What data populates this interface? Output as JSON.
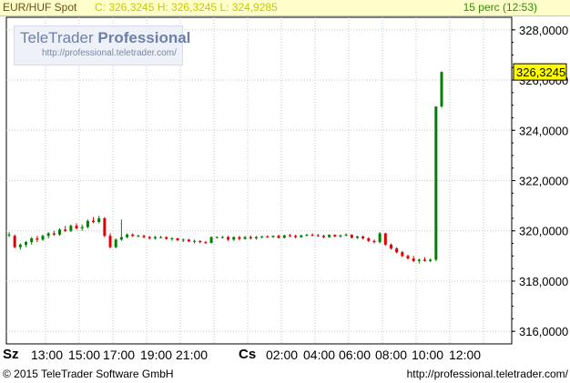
{
  "header": {
    "instrument": "EUR/HUF Spot",
    "ohlc": "C: 326,3245 H: 326,3245 L: 324,9285",
    "period": "15 perc (12:53)"
  },
  "logo": {
    "title_part1": "TeleTrader",
    "title_part2": "Professional",
    "url": "http://professional.teletrader.com/"
  },
  "footer": {
    "copyright": "© 2015 TeleTrader Software GmbH",
    "url": "http://professional.teletrader.com/"
  },
  "colors": {
    "up": "#008000",
    "down": "#e00000",
    "neutral": "#00ffff",
    "price_marker": "#ffff00"
  },
  "chart_data": {
    "type": "candlestick",
    "y_axis": {
      "min": 315.5,
      "max": 328.5,
      "ticks": [
        316,
        318,
        320,
        322,
        324,
        326,
        328
      ],
      "tick_labels": [
        "316,0000",
        "318,0000",
        "320,0000",
        "322,0000",
        "324,0000",
        "326,0000",
        "328,0000"
      ],
      "last_price_label": "326,3245",
      "last_price": 326.3245
    },
    "x_axis": {
      "day_labels": [
        {
          "label": "Sz",
          "pos": 0.0
        },
        {
          "label": "Cs",
          "pos": 0.5
        }
      ],
      "time_labels": [
        {
          "label": "13:00",
          "pos": 0.0
        },
        {
          "label": "15:00",
          "pos": 0.0
        },
        {
          "label": "17:00",
          "pos": 0.0
        },
        {
          "label": "19:00",
          "pos": 0.0
        },
        {
          "label": "21:00",
          "pos": 0.0
        },
        {
          "label": "02:00",
          "pos": 0.0
        },
        {
          "label": "04:00",
          "pos": 0.0
        },
        {
          "label": "06:00",
          "pos": 0.0
        },
        {
          "label": "08:00",
          "pos": 0.0
        },
        {
          "label": "10:00",
          "pos": 0.0
        },
        {
          "label": "12:00",
          "pos": 0.0
        }
      ]
    },
    "grid": true,
    "candles": [
      [
        319.85,
        319.95,
        319.75,
        319.85
      ],
      [
        319.8,
        319.85,
        319.3,
        319.35
      ],
      [
        319.35,
        319.5,
        319.25,
        319.45
      ],
      [
        319.45,
        319.6,
        319.35,
        319.55
      ],
      [
        319.55,
        319.75,
        319.45,
        319.7
      ],
      [
        319.7,
        319.8,
        319.55,
        319.65
      ],
      [
        319.65,
        319.85,
        319.6,
        319.8
      ],
      [
        319.8,
        319.95,
        319.7,
        319.9
      ],
      [
        319.9,
        320.0,
        319.8,
        319.85
      ],
      [
        319.85,
        320.1,
        319.8,
        320.05
      ],
      [
        320.05,
        320.2,
        319.95,
        320.0
      ],
      [
        320.0,
        320.25,
        319.95,
        320.2
      ],
      [
        320.2,
        320.3,
        320.05,
        320.1
      ],
      [
        320.1,
        320.25,
        320.0,
        320.15
      ],
      [
        320.15,
        320.45,
        320.1,
        320.4
      ],
      [
        320.4,
        320.55,
        320.3,
        320.35
      ],
      [
        320.35,
        320.6,
        320.3,
        320.5
      ],
      [
        320.5,
        320.55,
        319.75,
        319.8
      ],
      [
        319.8,
        319.9,
        319.3,
        319.35
      ],
      [
        319.35,
        319.7,
        319.3,
        319.65
      ],
      [
        319.65,
        320.45,
        319.6,
        319.75
      ],
      [
        319.75,
        319.9,
        319.7,
        319.85
      ],
      [
        319.85,
        319.9,
        319.75,
        319.8
      ],
      [
        319.8,
        319.85,
        319.75,
        319.8
      ],
      [
        319.8,
        319.85,
        319.7,
        319.75
      ],
      [
        319.75,
        319.8,
        319.65,
        319.7
      ],
      [
        319.7,
        319.8,
        319.65,
        319.75
      ],
      [
        319.75,
        319.8,
        319.7,
        319.75
      ],
      [
        319.75,
        319.78,
        319.65,
        319.68
      ],
      [
        319.68,
        319.75,
        319.6,
        319.7
      ],
      [
        319.7,
        319.72,
        319.6,
        319.62
      ],
      [
        319.62,
        319.7,
        319.55,
        319.65
      ],
      [
        319.65,
        319.68,
        319.55,
        319.58
      ],
      [
        319.58,
        319.65,
        319.5,
        319.6
      ],
      [
        319.6,
        319.62,
        319.5,
        319.55
      ],
      [
        319.55,
        319.6,
        319.48,
        319.52
      ],
      [
        319.52,
        319.78,
        319.5,
        319.75
      ],
      [
        319.75,
        319.78,
        319.7,
        319.75
      ],
      [
        319.75,
        319.8,
        319.7,
        319.75
      ],
      [
        319.75,
        319.8,
        319.6,
        319.65
      ],
      [
        319.65,
        319.78,
        319.6,
        319.75
      ],
      [
        319.75,
        319.8,
        319.62,
        319.68
      ],
      [
        319.68,
        319.8,
        319.65,
        319.75
      ],
      [
        319.75,
        319.82,
        319.65,
        319.7
      ],
      [
        319.7,
        319.8,
        319.65,
        319.75
      ],
      [
        319.75,
        319.8,
        319.7,
        319.78
      ],
      [
        319.78,
        319.82,
        319.72,
        319.75
      ],
      [
        319.75,
        319.82,
        319.72,
        319.8
      ],
      [
        319.8,
        319.85,
        319.7,
        319.72
      ],
      [
        319.72,
        319.85,
        319.7,
        319.82
      ],
      [
        319.82,
        319.88,
        319.75,
        319.8
      ],
      [
        319.8,
        319.85,
        319.7,
        319.75
      ],
      [
        319.75,
        319.85,
        319.72,
        319.82
      ],
      [
        319.82,
        319.88,
        319.78,
        319.84
      ],
      [
        319.84,
        319.9,
        319.78,
        319.82
      ],
      [
        319.82,
        319.88,
        319.76,
        319.8
      ],
      [
        319.8,
        319.85,
        319.7,
        319.75
      ],
      [
        319.75,
        319.86,
        319.72,
        319.84
      ],
      [
        319.84,
        319.86,
        319.74,
        319.78
      ],
      [
        319.78,
        319.85,
        319.72,
        319.82
      ],
      [
        319.82,
        319.9,
        319.78,
        319.85
      ],
      [
        319.85,
        319.86,
        319.7,
        319.72
      ],
      [
        319.72,
        319.8,
        319.68,
        319.78
      ],
      [
        319.78,
        319.8,
        319.65,
        319.7
      ],
      [
        319.7,
        319.75,
        319.55,
        319.6
      ],
      [
        319.6,
        319.65,
        319.5,
        319.55
      ],
      [
        319.55,
        319.95,
        319.5,
        319.9
      ],
      [
        319.9,
        319.92,
        319.4,
        319.45
      ],
      [
        319.45,
        319.5,
        319.25,
        319.3
      ],
      [
        319.3,
        319.35,
        319.1,
        319.15
      ],
      [
        319.15,
        319.2,
        318.95,
        319.0
      ],
      [
        319.0,
        319.05,
        318.85,
        318.9
      ],
      [
        318.9,
        319.0,
        318.75,
        318.8
      ],
      [
        318.8,
        318.9,
        318.7,
        318.85
      ],
      [
        318.85,
        318.95,
        318.78,
        318.8
      ],
      [
        318.8,
        318.9,
        318.75,
        318.85
      ],
      [
        318.85,
        324.95,
        318.8,
        324.95
      ],
      [
        324.95,
        326.35,
        324.9,
        326.32
      ]
    ]
  }
}
